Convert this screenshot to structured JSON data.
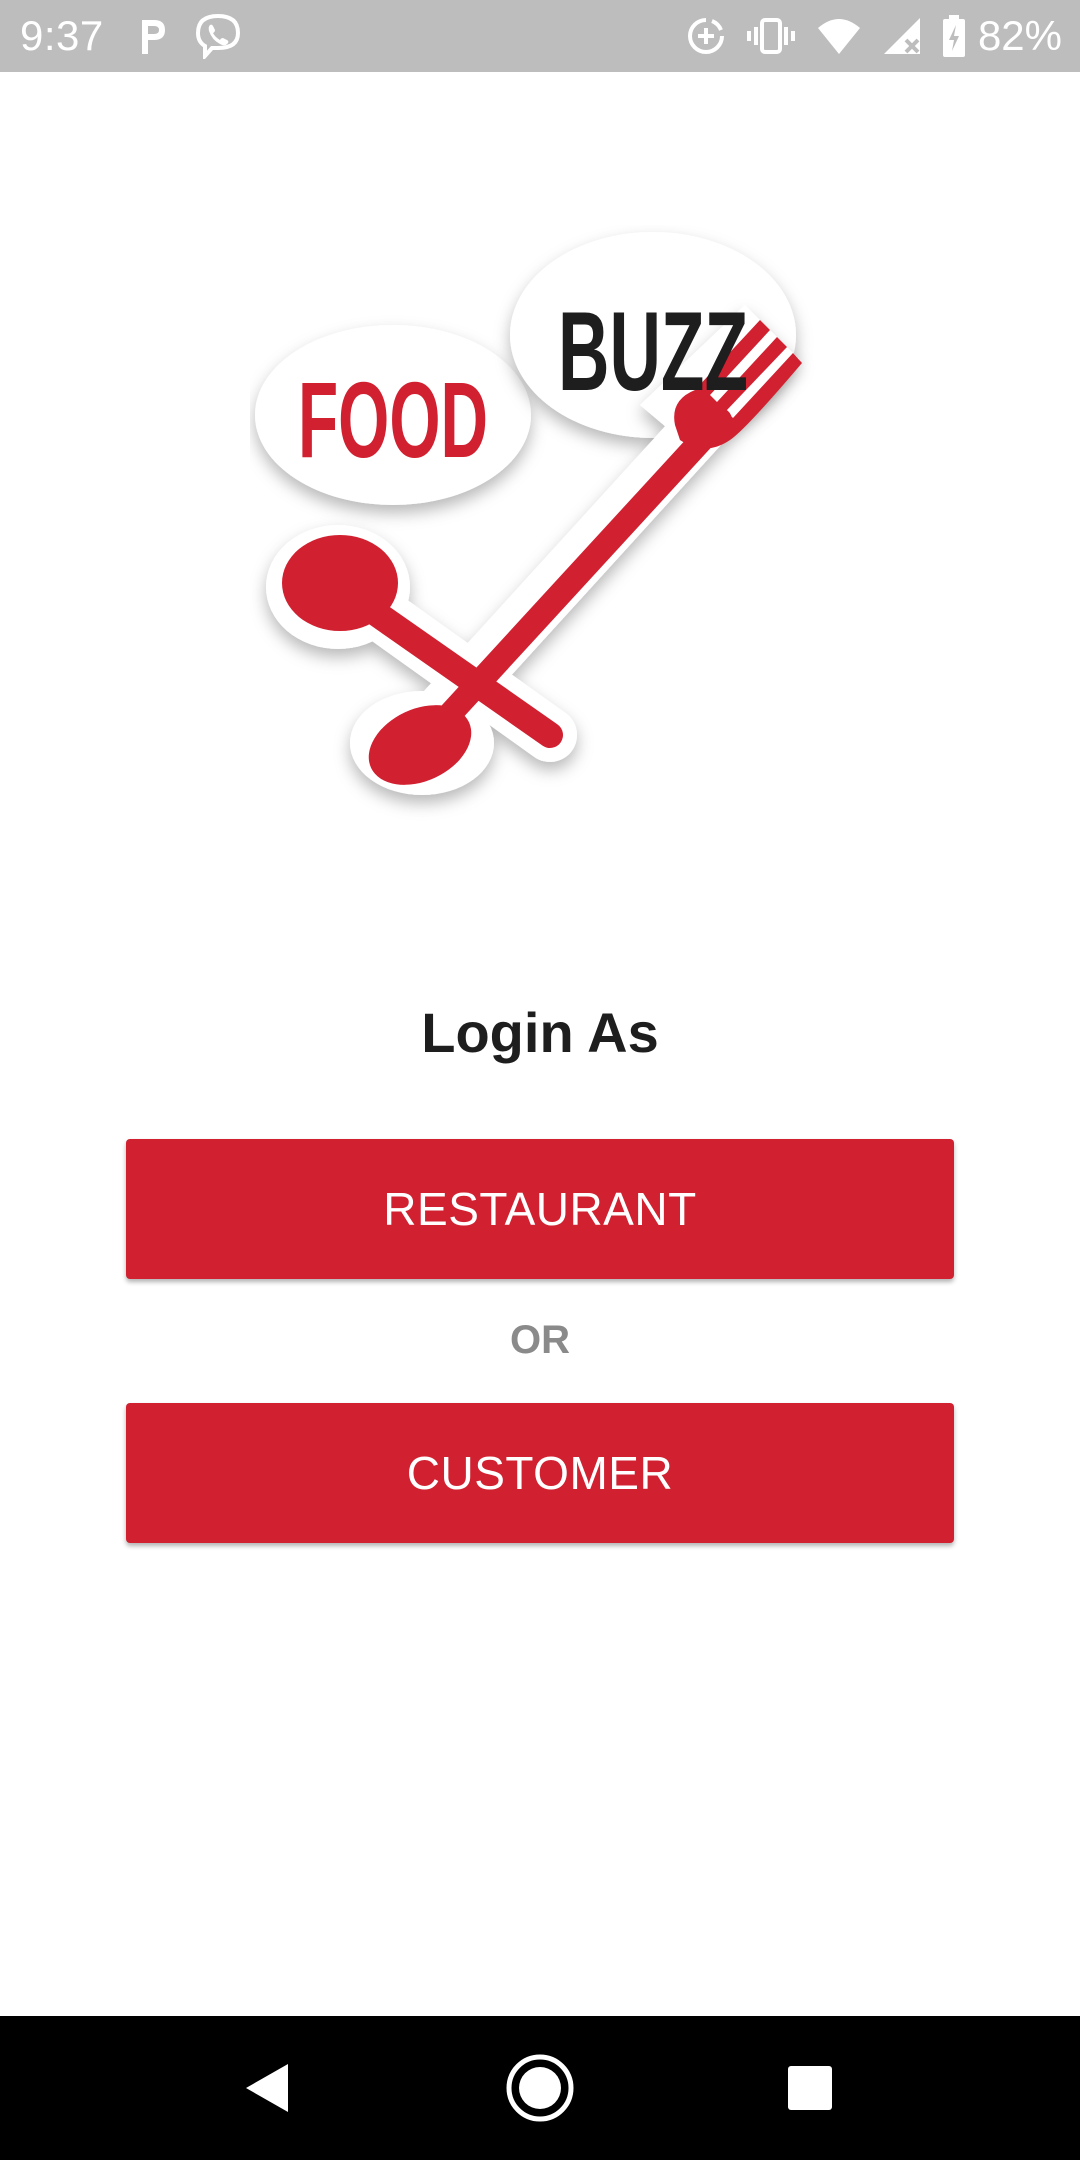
{
  "status_bar": {
    "time": "9:37",
    "battery": "82%",
    "icons_left": [
      "parking-icon",
      "viber-icon"
    ],
    "icons_right": [
      "data-saver-icon",
      "vibrate-icon",
      "wifi-icon",
      "cell-signal-icon",
      "battery-icon"
    ]
  },
  "logo": {
    "word_food": "FOOD",
    "word_buzz": "BUZZ",
    "brand_red": "#d12030",
    "brand_dark": "#1e1e1e"
  },
  "login": {
    "title": "Login As",
    "restaurant_label": "RESTAURANT",
    "or_label": "OR",
    "customer_label": "CUSTOMER",
    "button_color": "#d12030"
  },
  "nav_bar": {
    "items": [
      "back",
      "home",
      "recents"
    ]
  }
}
